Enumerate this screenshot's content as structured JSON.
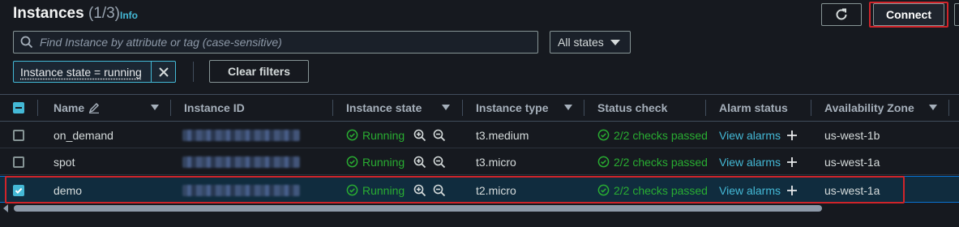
{
  "header": {
    "title": "Instances",
    "count": "(1/3)",
    "info_link": "Info",
    "connect_label": "Connect"
  },
  "search": {
    "placeholder": "Find Instance by attribute or tag (case-sensitive)",
    "value": ""
  },
  "states_filter": {
    "selected": "All states"
  },
  "active_filter": {
    "label": "Instance state = running"
  },
  "clear_filters_label": "Clear filters",
  "table": {
    "columns": [
      "Name",
      "Instance ID",
      "Instance state",
      "Instance type",
      "Status check",
      "Alarm status",
      "Availability Zone"
    ],
    "rows": [
      {
        "name": "on_demand",
        "state": "Running",
        "type": "t3.medium",
        "status": "2/2 checks passed",
        "alarm": "View alarms",
        "zone": "us-west-1b",
        "selected": false
      },
      {
        "name": "spot",
        "state": "Running",
        "type": "t3.micro",
        "status": "2/2 checks passed",
        "alarm": "View alarms",
        "zone": "us-west-1a",
        "selected": false
      },
      {
        "name": "demo",
        "state": "Running",
        "type": "t2.micro",
        "status": "2/2 checks passed",
        "alarm": "View alarms",
        "zone": "us-west-1a",
        "selected": true
      }
    ]
  },
  "colors": {
    "background": "#16191f",
    "link": "#44b9d6",
    "running_green": "#29ad32",
    "highlight_red": "#d0242a",
    "selected_row": "#102c3e"
  },
  "icons": [
    "refresh-icon",
    "search-icon",
    "caret-down-icon",
    "close-icon",
    "edit-pencil-icon",
    "sort-icon",
    "check-circle-icon",
    "zoom-in-icon",
    "zoom-out-icon",
    "plus-icon"
  ]
}
